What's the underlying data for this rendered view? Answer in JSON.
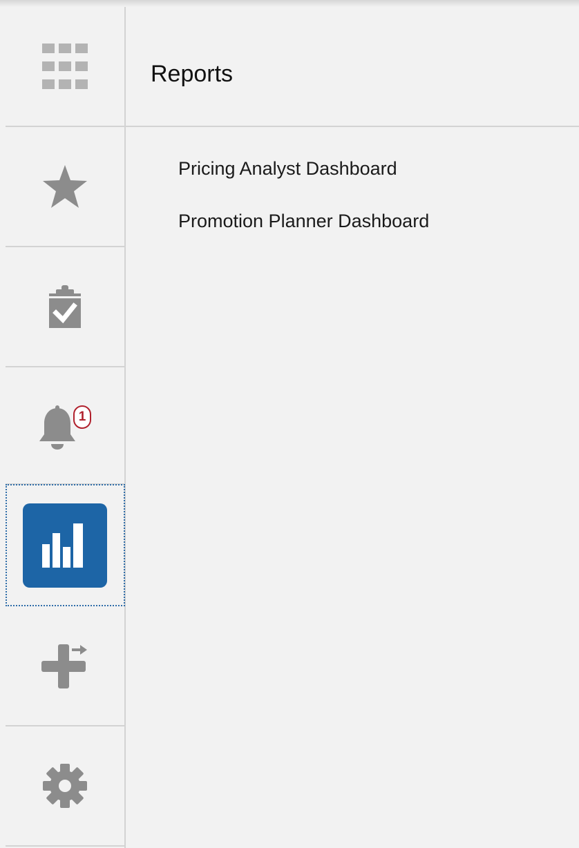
{
  "header": {
    "title": "Reports"
  },
  "rail": {
    "items": [
      {
        "name": "apps",
        "icon": "grid-icon"
      },
      {
        "name": "favorites",
        "icon": "star-icon"
      },
      {
        "name": "tasks",
        "icon": "clipboard-check-icon"
      },
      {
        "name": "notifications",
        "icon": "bell-icon",
        "badge": "1"
      },
      {
        "name": "reports",
        "icon": "bar-chart-icon",
        "selected": true
      },
      {
        "name": "navigator",
        "icon": "plus-arrow-icon"
      },
      {
        "name": "settings",
        "icon": "gear-icon"
      }
    ]
  },
  "reports": {
    "items": [
      {
        "label": "Pricing Analyst Dashboard"
      },
      {
        "label": "Promotion Planner Dashboard"
      }
    ]
  },
  "colors": {
    "accent": "#1d65a6",
    "badge": "#b0202c",
    "icon": "#8c8c8c",
    "background": "#f2f2f2"
  }
}
